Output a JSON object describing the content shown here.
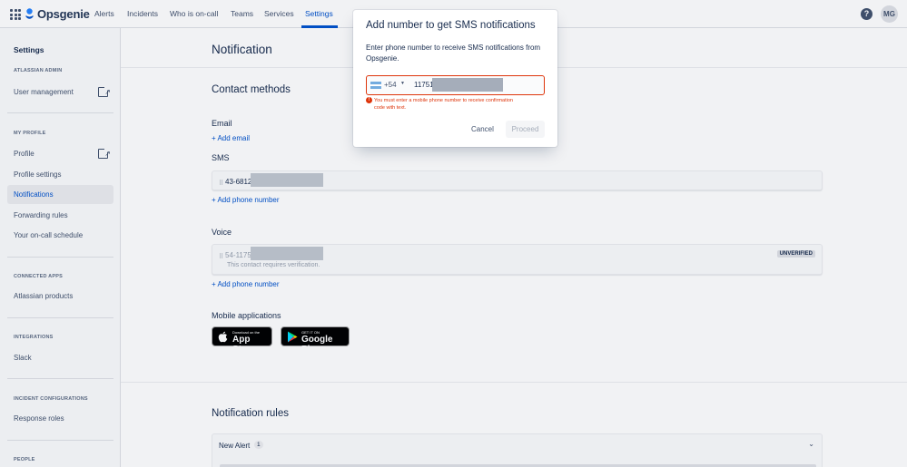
{
  "topnav": {
    "brand": "Opsgenie",
    "items": [
      "Alerts",
      "Incidents",
      "Who is on-call",
      "Teams",
      "Services",
      "Settings"
    ],
    "avatar_initials": "MG",
    "help_glyph": "?",
    "accent": "#0052cc"
  },
  "sidebar": {
    "title": "Settings",
    "sections": {
      "atlassian_admin": "ATLASSIAN ADMIN",
      "my_profile": "MY PROFILE",
      "connected_apps": "CONNECTED APPS",
      "integrations": "INTEGRATIONS",
      "incident_configurations": "INCIDENT CONFIGURATIONS",
      "people": "PEOPLE"
    },
    "items": {
      "user_management": "User management",
      "profile": "Profile",
      "profile_settings": "Profile settings",
      "notifications": "Notifications",
      "forwarding_rules": "Forwarding rules",
      "on_call_schedule": "Your on-call schedule",
      "atlassian_products": "Atlassian products",
      "slack": "Slack",
      "response_roles": "Response roles"
    }
  },
  "main": {
    "title": "Notification",
    "contact_methods": {
      "heading": "Contact methods",
      "email_label": "Email",
      "add_email": "+ Add email",
      "sms_label": "SMS",
      "sms_number": "43-6812",
      "add_phone_sms": "+ Add phone number",
      "voice_label": "Voice",
      "voice_number": "54-1175",
      "voice_note": "This contact requires verification.",
      "voice_badge": "UNVERIFIED",
      "add_phone_voice": "+ Add phone number"
    },
    "mobile": {
      "heading": "Mobile applications",
      "app_store_small": "Download on the",
      "app_store_big": "App Store",
      "google_small": "GET IT ON",
      "google_big": "Google Play"
    },
    "rules": {
      "heading": "Notification rules",
      "rule_name": "New Alert",
      "rule_count": "1"
    }
  },
  "modal": {
    "title": "Add number to get SMS notifications",
    "description": "Enter phone number to receive SMS notifications from Opsgenie.",
    "country_code": "+54",
    "number_value": "11751",
    "error": "You must enter a mobile phone number to receive confirmation code with text.",
    "cancel_label": "Cancel",
    "proceed_label": "Proceed",
    "error_color": "#de350b"
  }
}
